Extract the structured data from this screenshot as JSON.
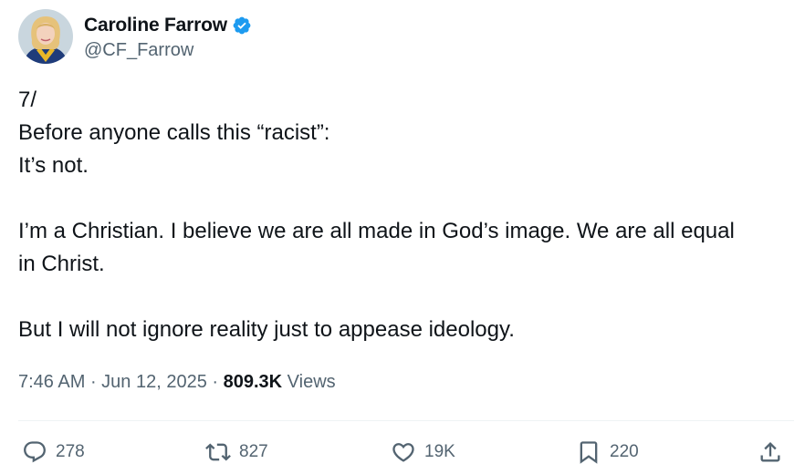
{
  "author": {
    "display_name": "Caroline Farrow",
    "handle": "@CF_Farrow",
    "verified": true,
    "verified_color": "#1d9bf0",
    "avatar_icon": "profile-photo"
  },
  "tweet": {
    "paragraphs": [
      [
        "7/",
        "Before anyone calls this “racist”:",
        "It’s not."
      ],
      [
        "I’m a Christian. I believe we are all made in God’s image. We are all equal",
        "in Christ."
      ],
      [
        "But I will not ignore reality just to appease ideology."
      ]
    ]
  },
  "meta": {
    "time": "7:46 AM",
    "separator": " · ",
    "date": "Jun 12, 2025",
    "views_count": "809.3K",
    "views_label": " Views"
  },
  "actions": {
    "replies": {
      "count": "278",
      "icon": "reply-icon"
    },
    "reposts": {
      "count": "827",
      "icon": "repost-icon"
    },
    "likes": {
      "count": "19K",
      "icon": "like-icon"
    },
    "bookmarks": {
      "count": "220",
      "icon": "bookmark-icon"
    },
    "share": {
      "icon": "share-icon"
    }
  }
}
